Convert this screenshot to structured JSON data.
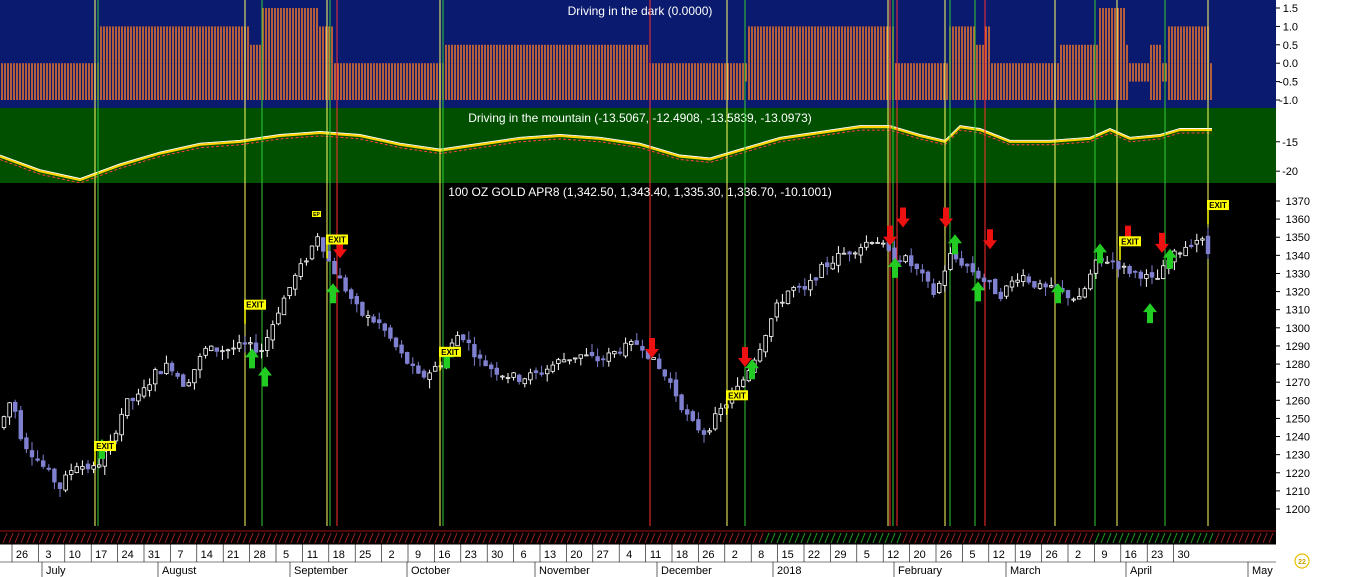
{
  "colors": {
    "panel1_bg": "#0a1a6e",
    "panel2_bg": "#005000",
    "panel3_bg": "#000000",
    "histogram": "#e07030",
    "line_main": "#ffd400",
    "line_signal": "#ffffff",
    "line_dashed": "#ff4040",
    "candle_up": "#ffffff",
    "candle_down": "#8080d0",
    "vline_yellow": "#ffff66",
    "vline_green": "#33cc33",
    "vline_red": "#ff3030",
    "arrow_up": "#22cc22",
    "arrow_down": "#ee1111",
    "exit_badge": "#ffff00"
  },
  "panels": {
    "dark": {
      "title": "Driving in the dark (0.0000)",
      "ticks": [
        "1.5",
        "1.0",
        "0.5",
        "0.0",
        "-0.5",
        "-1.0"
      ]
    },
    "mountain": {
      "title": "Driving in the mountain (-13.5067, -12.4908, -13.5839, -13.0973)",
      "ticks": [
        "-15",
        "-20"
      ]
    },
    "price": {
      "title": "100 OZ GOLD APR8 (1,342.50, 1,343.40, 1,335.30, 1,336.70, -10.1001)",
      "ticks": [
        "1370",
        "1360",
        "1350",
        "1340",
        "1330",
        "1320",
        "1310",
        "1300",
        "1290",
        "1280",
        "1270",
        "1260",
        "1250",
        "1240",
        "1230",
        "1220",
        "1210",
        "1200"
      ]
    }
  },
  "x_axis": {
    "days": [
      "26",
      "3",
      "10",
      "17",
      "24",
      "31",
      "7",
      "14",
      "21",
      "28",
      "5",
      "11",
      "18",
      "25",
      "2",
      "9",
      "16",
      "23",
      "30",
      "6",
      "13",
      "20",
      "27",
      "4",
      "11",
      "18",
      "26",
      "2",
      "8",
      "15",
      "22",
      "29",
      "5",
      "12",
      "20",
      "26",
      "5",
      "12",
      "19",
      "26",
      "2",
      "9",
      "16",
      "23",
      "30"
    ],
    "months": [
      "July",
      "August",
      "September",
      "October",
      "November",
      "December",
      "2018",
      "February",
      "March",
      "April",
      "May"
    ]
  },
  "badges": {
    "exit": "EXIT",
    "small": "EP",
    "corner": "22"
  },
  "chart_data": {
    "type": "candlestick",
    "title": "100 OZ GOLD APR8 (1,342.50, 1,343.40, 1,335.30, 1,336.70, -10.1001)",
    "ylim": [
      1195,
      1375
    ],
    "last_bar": {
      "open": 1342.5,
      "high": 1343.4,
      "low": 1335.3,
      "close": 1336.7,
      "change": -10.1001
    },
    "approx_close_path": [
      [
        0,
        1245
      ],
      [
        12,
        1262
      ],
      [
        22,
        1238
      ],
      [
        45,
        1222
      ],
      [
        60,
        1212
      ],
      [
        75,
        1225
      ],
      [
        95,
        1222
      ],
      [
        110,
        1235
      ],
      [
        125,
        1258
      ],
      [
        140,
        1262
      ],
      [
        155,
        1275
      ],
      [
        170,
        1280
      ],
      [
        185,
        1268
      ],
      [
        205,
        1288
      ],
      [
        225,
        1288
      ],
      [
        245,
        1290
      ],
      [
        262,
        1288
      ],
      [
        280,
        1312
      ],
      [
        295,
        1328
      ],
      [
        308,
        1340
      ],
      [
        318,
        1352
      ],
      [
        330,
        1335
      ],
      [
        345,
        1322
      ],
      [
        360,
        1308
      ],
      [
        380,
        1302
      ],
      [
        400,
        1286
      ],
      [
        420,
        1272
      ],
      [
        440,
        1280
      ],
      [
        460,
        1298
      ],
      [
        480,
        1282
      ],
      [
        500,
        1275
      ],
      [
        520,
        1272
      ],
      [
        540,
        1275
      ],
      [
        560,
        1282
      ],
      [
        580,
        1285
      ],
      [
        600,
        1282
      ],
      [
        620,
        1288
      ],
      [
        640,
        1292
      ],
      [
        655,
        1280
      ],
      [
        670,
        1270
      ],
      [
        690,
        1248
      ],
      [
        705,
        1242
      ],
      [
        720,
        1254
      ],
      [
        740,
        1268
      ],
      [
        760,
        1290
      ],
      [
        775,
        1310
      ],
      [
        790,
        1322
      ],
      [
        805,
        1320
      ],
      [
        820,
        1332
      ],
      [
        840,
        1340
      ],
      [
        860,
        1345
      ],
      [
        875,
        1350
      ],
      [
        890,
        1340
      ],
      [
        905,
        1338
      ],
      [
        920,
        1330
      ],
      [
        935,
        1318
      ],
      [
        950,
        1340
      ],
      [
        965,
        1335
      ],
      [
        980,
        1328
      ],
      [
        1000,
        1318
      ],
      [
        1020,
        1330
      ],
      [
        1040,
        1322
      ],
      [
        1060,
        1320
      ],
      [
        1080,
        1315
      ],
      [
        1095,
        1335
      ],
      [
        1110,
        1338
      ],
      [
        1125,
        1332
      ],
      [
        1140,
        1330
      ],
      [
        1155,
        1325
      ],
      [
        1170,
        1338
      ],
      [
        1185,
        1345
      ],
      [
        1200,
        1350
      ],
      [
        1212,
        1337
      ]
    ],
    "dark_histogram_levels": [
      [
        0,
        0.0
      ],
      [
        95,
        0.0
      ],
      [
        100,
        1.0
      ],
      [
        245,
        1.0
      ],
      [
        250,
        0.5
      ],
      [
        262,
        1.5
      ],
      [
        315,
        1.5
      ],
      [
        320,
        1.0
      ],
      [
        335,
        0.0
      ],
      [
        440,
        0.0
      ],
      [
        445,
        0.5
      ],
      [
        645,
        0.5
      ],
      [
        650,
        0.0
      ],
      [
        740,
        0.0
      ],
      [
        745,
        -0.5
      ],
      [
        748,
        1.0
      ],
      [
        890,
        1.0
      ],
      [
        895,
        0.0
      ],
      [
        945,
        0.0
      ],
      [
        950,
        1.0
      ],
      [
        975,
        0.5
      ],
      [
        985,
        1.0
      ],
      [
        990,
        0.0
      ],
      [
        1055,
        0.0
      ],
      [
        1060,
        0.5
      ],
      [
        1095,
        0.5
      ],
      [
        1100,
        1.5
      ],
      [
        1120,
        1.5
      ],
      [
        1125,
        0.5
      ],
      [
        1128,
        -0.5
      ],
      [
        1145,
        -0.5
      ],
      [
        1150,
        0.5
      ],
      [
        1160,
        0.5
      ],
      [
        1163,
        -0.5
      ],
      [
        1168,
        1.0
      ],
      [
        1210,
        0.0
      ]
    ],
    "mountain_line": [
      [
        0,
        -17.5
      ],
      [
        40,
        -20.0
      ],
      [
        80,
        -21.5
      ],
      [
        120,
        -19.0
      ],
      [
        160,
        -17.0
      ],
      [
        200,
        -15.5
      ],
      [
        240,
        -15.0
      ],
      [
        280,
        -14.0
      ],
      [
        320,
        -13.5
      ],
      [
        360,
        -14.0
      ],
      [
        400,
        -15.5
      ],
      [
        440,
        -16.5
      ],
      [
        480,
        -15.5
      ],
      [
        520,
        -14.5
      ],
      [
        560,
        -14.0
      ],
      [
        600,
        -14.5
      ],
      [
        640,
        -15.5
      ],
      [
        680,
        -17.5
      ],
      [
        710,
        -18.0
      ],
      [
        740,
        -16.5
      ],
      [
        780,
        -14.5
      ],
      [
        820,
        -13.5
      ],
      [
        860,
        -12.5
      ],
      [
        890,
        -12.5
      ],
      [
        920,
        -14.0
      ],
      [
        945,
        -15.0
      ],
      [
        960,
        -12.5
      ],
      [
        980,
        -13.0
      ],
      [
        1010,
        -15.0
      ],
      [
        1050,
        -15.0
      ],
      [
        1090,
        -14.5
      ],
      [
        1110,
        -13.0
      ],
      [
        1130,
        -14.5
      ],
      [
        1160,
        -14.0
      ],
      [
        1180,
        -13.0
      ],
      [
        1212,
        -13.0
      ]
    ],
    "signals": {
      "yellow_lines": [
        95,
        245,
        327,
        440,
        727,
        888,
        945,
        1055,
        1117,
        1208
      ],
      "green_lines": [
        98,
        262,
        330,
        443,
        745,
        893,
        950,
        975,
        1095,
        1165
      ],
      "red_lines": [
        337,
        650,
        890,
        897,
        985
      ],
      "up_arrows": [
        [
          102,
          1232
        ],
        [
          252,
          1282
        ],
        [
          265,
          1272
        ],
        [
          333,
          1318
        ],
        [
          447,
          1282
        ],
        [
          752,
          1276
        ],
        [
          895,
          1332
        ],
        [
          955,
          1345
        ],
        [
          978,
          1319
        ],
        [
          1058,
          1318
        ],
        [
          1100,
          1340
        ],
        [
          1150,
          1307
        ],
        [
          1170,
          1337
        ]
      ],
      "down_arrows": [
        [
          340,
          1345
        ],
        [
          652,
          1290
        ],
        [
          745,
          1285
        ],
        [
          890,
          1352
        ],
        [
          903,
          1362
        ],
        [
          946,
          1362
        ],
        [
          990,
          1350
        ],
        [
          1128,
          1352
        ],
        [
          1162,
          1348
        ]
      ],
      "exits": [
        [
          95,
          1232
        ],
        [
          245,
          1310
        ],
        [
          327,
          1346
        ],
        [
          440,
          1284
        ],
        [
          727,
          1260
        ],
        [
          1120,
          1345
        ],
        [
          1208,
          1365
        ]
      ]
    }
  }
}
